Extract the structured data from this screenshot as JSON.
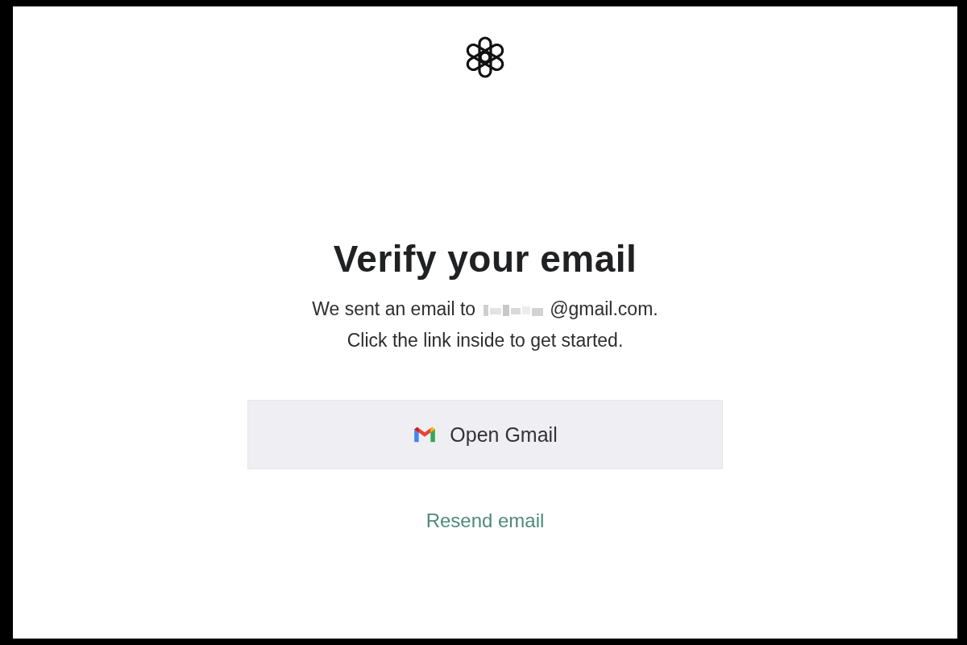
{
  "heading": "Verify your email",
  "message": {
    "before": "We sent an email to",
    "redacted": true,
    "after": "@gmail.com.",
    "line2": "Click the link inside to get started."
  },
  "open_button": {
    "label": "Open Gmail"
  },
  "resend_link": {
    "label": "Resend email"
  }
}
